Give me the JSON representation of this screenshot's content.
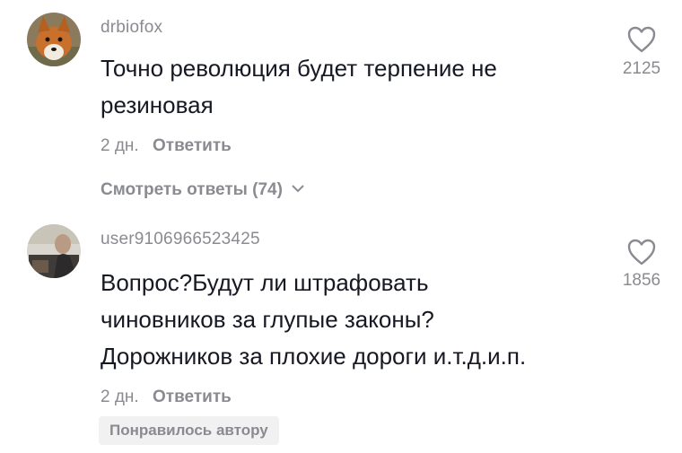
{
  "comments": [
    {
      "username": "drbiofox",
      "text_lines": [
        "Точно революция будет терпение не",
        "резиновая"
      ],
      "time": "2 дн.",
      "reply_label": "Ответить",
      "likes": "2125",
      "view_replies_label": "Смотреть ответы (74)",
      "avatar_icon": "fox-avatar-photo"
    },
    {
      "username": "user9106966523425",
      "text_lines": [
        "Вопрос?Будут ли штрафовать",
        "чиновников за глупые законы?",
        "Дорожников за плохие дороги и.т.д.и.п."
      ],
      "time": "2 дн.",
      "reply_label": "Ответить",
      "likes": "1856",
      "liked_by_author_label": "Понравилось автору",
      "avatar_icon": "person-avatar-photo"
    }
  ],
  "icons": {
    "like": "heart-outline-icon",
    "expand": "chevron-down-icon"
  },
  "colors": {
    "primary_text": "#161823",
    "secondary_text": "#8a8b91",
    "badge_bg": "#f1f1f2"
  }
}
